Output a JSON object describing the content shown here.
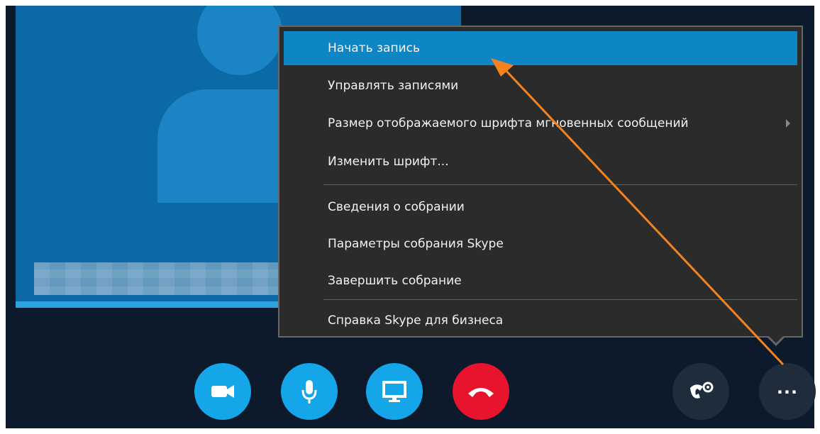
{
  "menu": {
    "items": [
      {
        "label": "Начать запись"
      },
      {
        "label": "Управлять записями"
      },
      {
        "label": "Размер отображаемого шрифта мгновенных сообщений"
      },
      {
        "label": "Изменить шрифт..."
      },
      {
        "label": "Сведения о собрании"
      },
      {
        "label": "Параметры собрания Skype"
      },
      {
        "label": "Завершить собрание"
      },
      {
        "label": "Справка Skype для бизнеса"
      }
    ],
    "highlighted_index": 0
  },
  "controls": {
    "video": {
      "icon": "video-camera-icon"
    },
    "mic": {
      "icon": "microphone-icon"
    },
    "share": {
      "icon": "monitor-icon"
    },
    "hangup": {
      "icon": "hang-up-phone-icon"
    },
    "call_controls": {
      "icon": "phone-settings-icon"
    },
    "more": {
      "icon": "more-options-icon",
      "label": "..."
    }
  },
  "colors": {
    "accent": "#0e86c6",
    "call_button": "#15a6ea",
    "hangup": "#e8132c",
    "annotation_arrow": "#f58220",
    "background": "#0c1a2c"
  }
}
